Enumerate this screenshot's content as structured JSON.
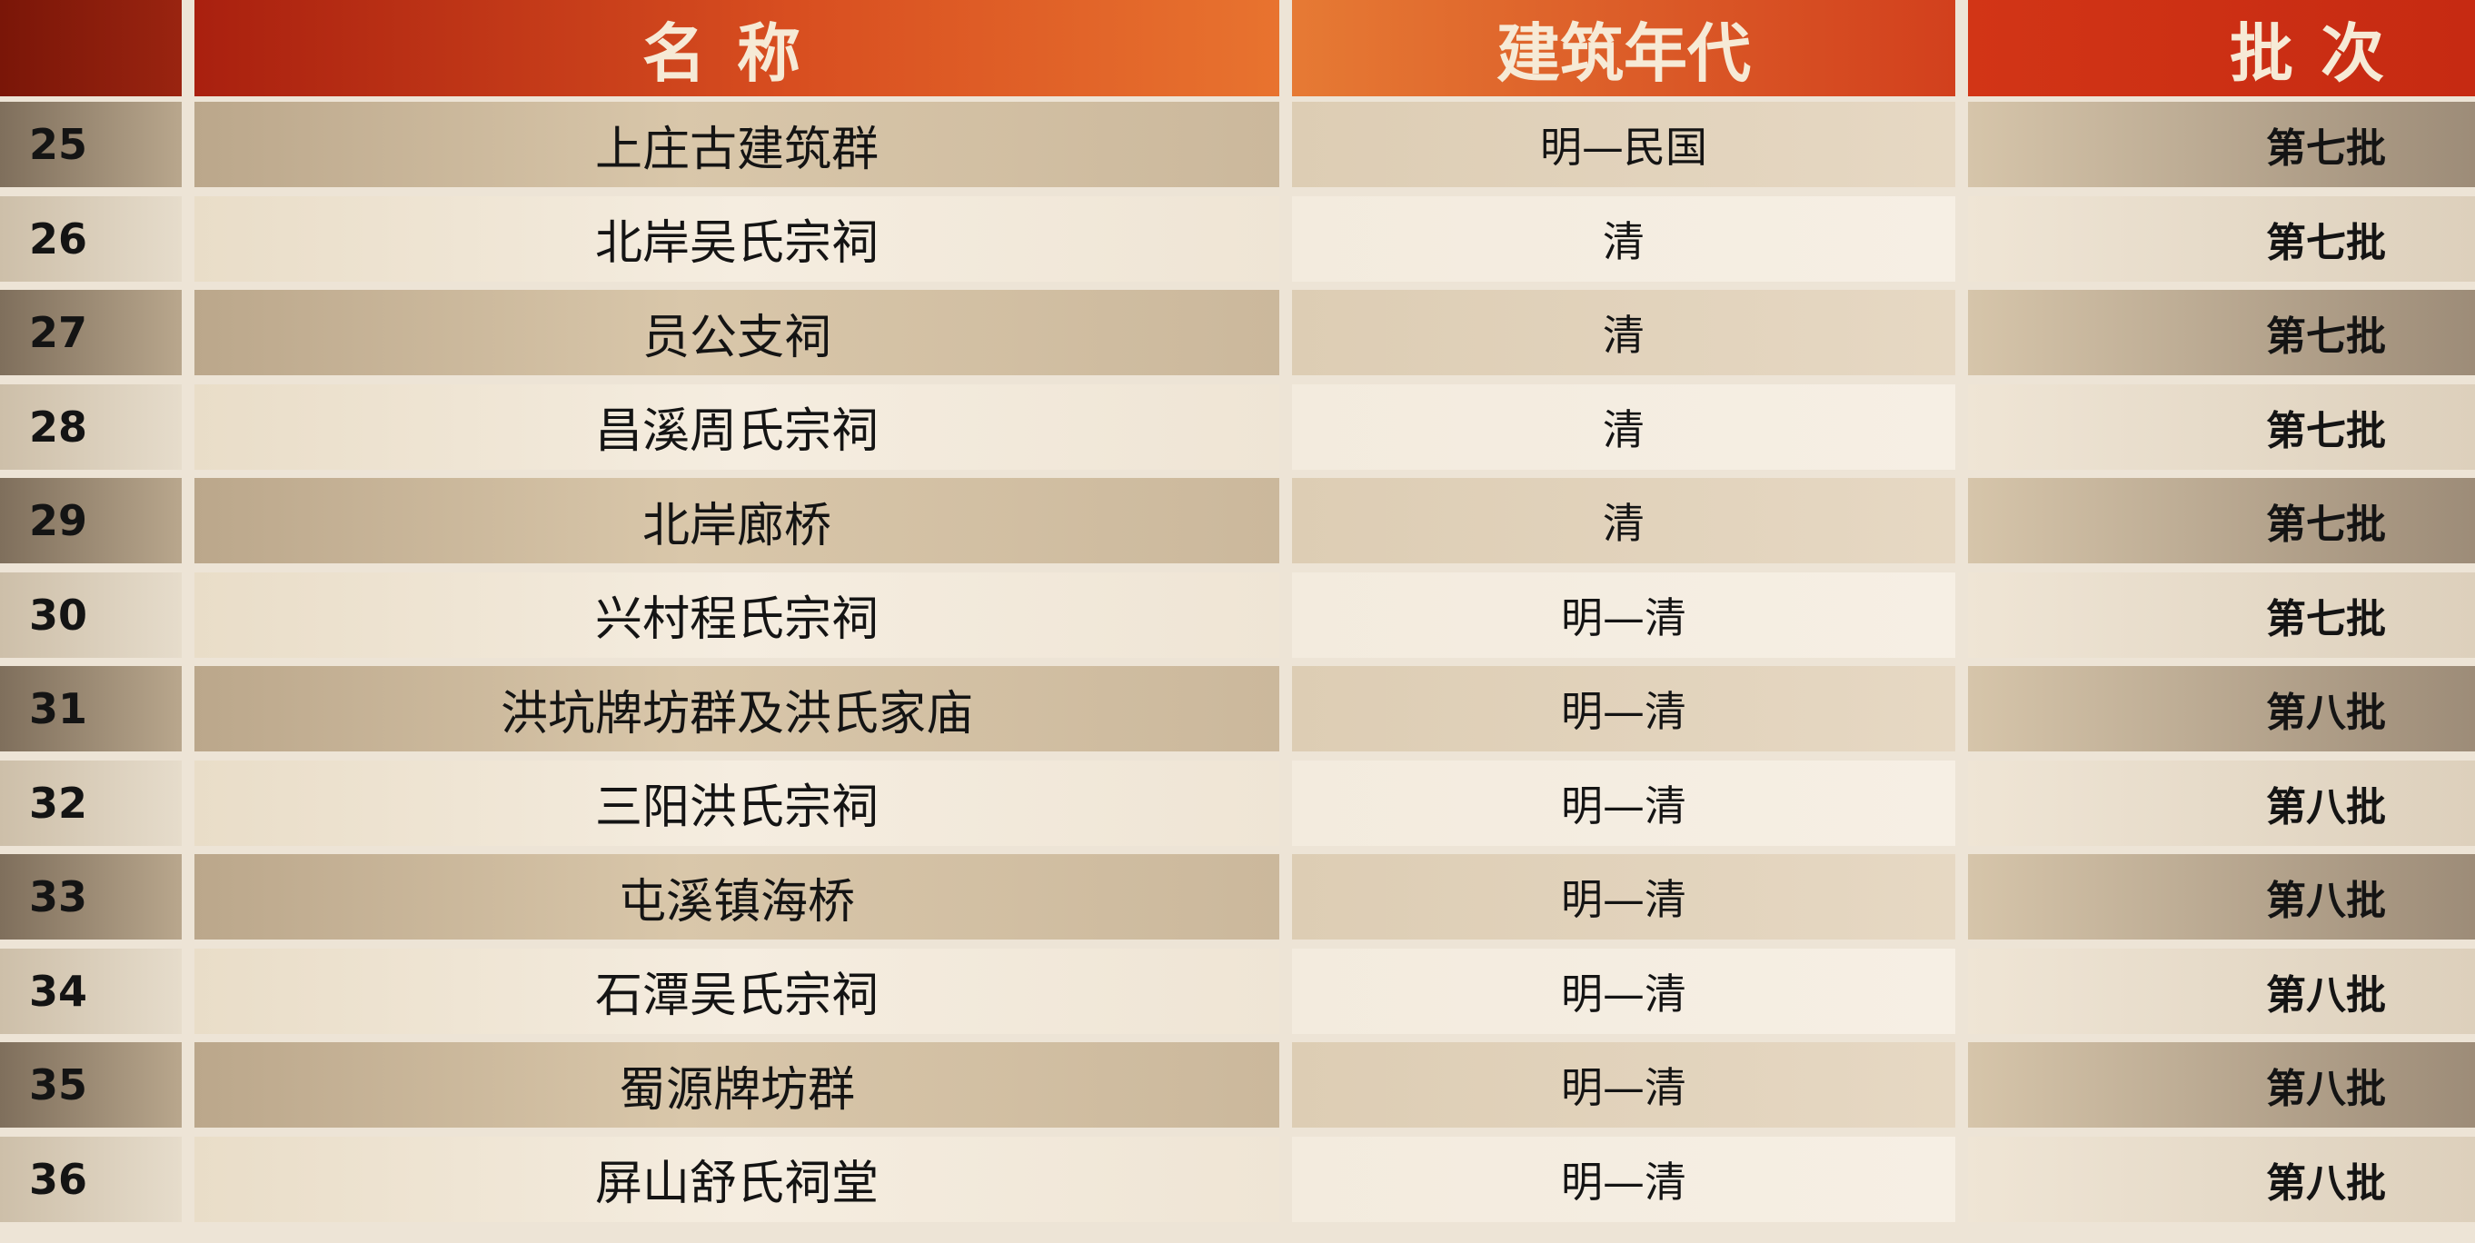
{
  "header": {
    "name": "名称",
    "era": "建筑年代",
    "batch": "批次"
  },
  "rows": [
    {
      "num": "25",
      "name": "上庄古建筑群",
      "era": "明—民国",
      "batch": "第七批"
    },
    {
      "num": "26",
      "name": "北岸吴氏宗祠",
      "era": "清",
      "batch": "第七批"
    },
    {
      "num": "27",
      "name": "员公支祠",
      "era": "清",
      "batch": "第七批"
    },
    {
      "num": "28",
      "name": "昌溪周氏宗祠",
      "era": "清",
      "batch": "第七批"
    },
    {
      "num": "29",
      "name": "北岸廊桥",
      "era": "清",
      "batch": "第七批"
    },
    {
      "num": "30",
      "name": "兴村程氏宗祠",
      "era": "明—清",
      "batch": "第七批"
    },
    {
      "num": "31",
      "name": "洪坑牌坊群及洪氏家庙",
      "era": "明—清",
      "batch": "第八批"
    },
    {
      "num": "32",
      "name": "三阳洪氏宗祠",
      "era": "明—清",
      "batch": "第八批"
    },
    {
      "num": "33",
      "name": "屯溪镇海桥",
      "era": "明—清",
      "batch": "第八批"
    },
    {
      "num": "34",
      "name": "石潭吴氏宗祠",
      "era": "明—清",
      "batch": "第八批"
    },
    {
      "num": "35",
      "name": "蜀源牌坊群",
      "era": "明—清",
      "batch": "第八批"
    },
    {
      "num": "36",
      "name": "屏山舒氏祠堂",
      "era": "明—清",
      "batch": "第八批"
    }
  ]
}
